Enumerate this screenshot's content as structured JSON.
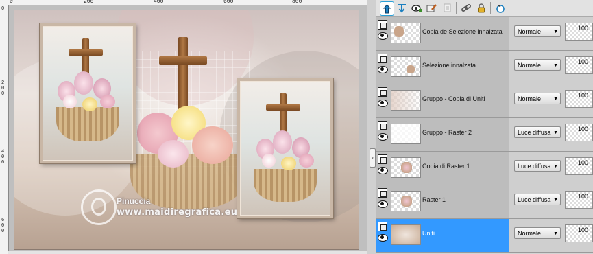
{
  "ruler": {
    "top_labels": [
      "0",
      "200",
      "400",
      "600",
      "800"
    ],
    "left_labels": [
      "0",
      "200",
      "400",
      "600"
    ]
  },
  "canvas": {
    "watermark_name": "Pinuccia",
    "watermark_url": "www.maidiregrafica.eu"
  },
  "toolbar": {
    "icons": [
      "new-raster-layer-icon",
      "merge-down-icon",
      "layer-visibility-icon",
      "edit-layer-icon",
      "duplicate-layer-icon",
      "link-layers-icon",
      "lock-icon",
      "mask-icon"
    ]
  },
  "layers": [
    {
      "name": "Copia de Selezione innalzata",
      "blend": "Normale",
      "opacity": "100",
      "selected": false
    },
    {
      "name": "Selezione innalzata",
      "blend": "Normale",
      "opacity": "100",
      "selected": false
    },
    {
      "name": "Gruppo - Copia di Uniti",
      "blend": "Normale",
      "opacity": "100",
      "selected": false
    },
    {
      "name": "Gruppo - Raster 2",
      "blend": "Luce diffusa",
      "opacity": "100",
      "selected": false
    },
    {
      "name": "Copia di Raster 1",
      "blend": "Luce diffusa",
      "opacity": "100",
      "selected": false
    },
    {
      "name": "Raster 1",
      "blend": "Luce diffusa",
      "opacity": "100",
      "selected": false
    },
    {
      "name": "Uniti",
      "blend": "Normale",
      "opacity": "100",
      "selected": true
    }
  ],
  "colors": {
    "selected_row": "#3399ff",
    "accent_cyan": "#2a9fd6"
  }
}
